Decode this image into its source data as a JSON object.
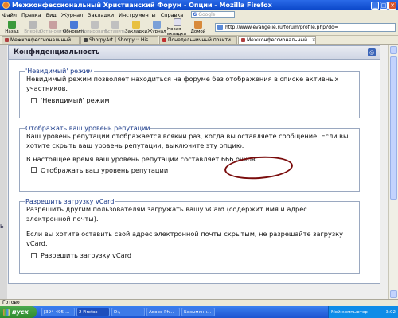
{
  "window": {
    "title": "Межконфессиональный Христианский Форум - Опции - Mozilla Firefox",
    "buttons": [
      "_",
      "□",
      "✕"
    ]
  },
  "menu": {
    "items": [
      "Файл",
      "Правка",
      "Вид",
      "Журнал",
      "Закладки",
      "Инструменты",
      "Справка"
    ],
    "search_placeholder": "Google"
  },
  "toolbar": {
    "back": "Назад",
    "forward": "Вперёд",
    "stop": "Остановить",
    "reload": "Обновить",
    "copy": "Копировать",
    "paste": "Вставить",
    "bookmarks": "Закладки",
    "history": "Журнал",
    "new_tab": "Новая вкладка",
    "home": "Домой",
    "address": "http://www.evangelie.ru/forum/profile.php?do="
  },
  "tabs": [
    {
      "label": "Межконфессиональный...",
      "active": false
    },
    {
      "label": "ShorpyArt | Shorpy :: His...",
      "active": false
    },
    {
      "label": "Понедельничный позити...",
      "active": false
    },
    {
      "label": "Межконфессиональный...",
      "active": true
    }
  ],
  "panel": {
    "title": "Конфиденциальность"
  },
  "sections": {
    "invisible": {
      "legend": "'Невидимый' режим",
      "description": "Невидимый режим позволяет находиться на форуме без отображения в списке активных участников.",
      "checkbox_label": "'Невидимый' режим"
    },
    "reputation": {
      "legend": "Отображать ваш уровень репутации",
      "description": "Ваш уровень репутации отображается всякий раз, когда вы оставляете сообщение. Если вы хотите скрыть ваш уровень репутации, выключите эту опцию.",
      "current_prefix": "В настоящее время ваш уровень репутации составляет ",
      "current_value": "666 очков.",
      "checkbox_label": "Отображать ваш уровень репутации"
    },
    "vcard": {
      "legend": "Разрешить загрузку vCard",
      "description": "Разрешить другим пользователям загружать вашу vCard (содержит имя и адрес электронной почты).",
      "note": "Если вы хотите оставить свой адрес электронной почты скрытым, не разрешайте загрузку vCard.",
      "checkbox_label": "Разрешить загрузку vCard"
    }
  },
  "left_strip_text": "Ь",
  "status": "Готово",
  "taskbar": {
    "start": "пуск",
    "tasks": [
      "[394-495-...",
      "2 Firefox",
      "D:\\",
      "Adobe Ph...",
      "Безымянн..."
    ],
    "tray_text": "Мой компьютер",
    "clock": "3:02"
  }
}
